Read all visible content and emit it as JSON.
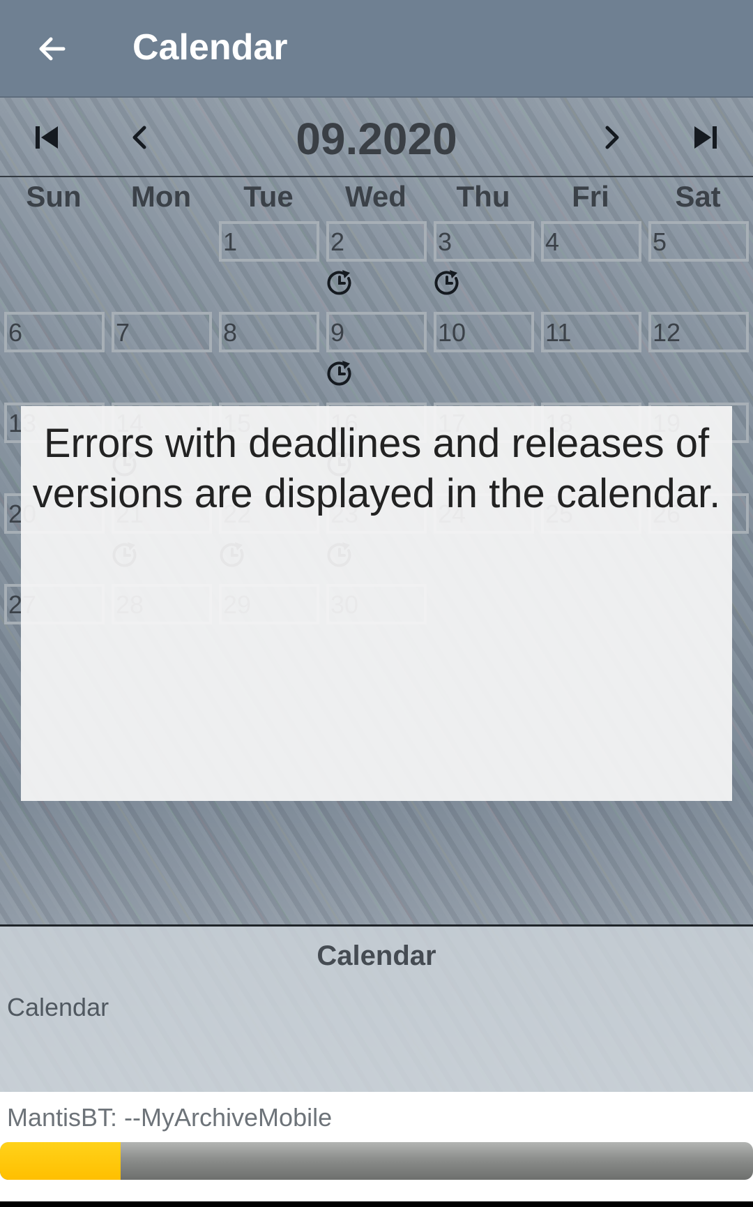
{
  "appbar": {
    "title": "Calendar",
    "back_icon": "arrow-left-icon"
  },
  "nav": {
    "month": "09.2020",
    "first_icon": "skip-first-icon",
    "prev_icon": "chevron-left-icon",
    "next_icon": "chevron-right-icon",
    "last_icon": "skip-last-icon"
  },
  "weekdays": [
    "Sun",
    "Mon",
    "Tue",
    "Wed",
    "Thu",
    "Fri",
    "Sat"
  ],
  "days": [
    "1",
    "2",
    "3",
    "4",
    "5",
    "6",
    "7",
    "8",
    "9",
    "10",
    "11",
    "12",
    "13",
    "14",
    "15",
    "16",
    "17",
    "18",
    "19",
    "20",
    "21",
    "22",
    "23",
    "24",
    "25",
    "26",
    "27",
    "28",
    "29",
    "30"
  ],
  "marker_icon": "deadline-clock-icon",
  "help": {
    "text": "Errors with deadlines and releases of versions are displayed in the calendar."
  },
  "info": {
    "heading": "Calendar",
    "body": "Calendar"
  },
  "footer": {
    "label": "MantisBT: --MyArchiveMobile",
    "progress": 0.16
  },
  "colors": {
    "appbar": "#6f8092",
    "progress_fill": "#ffbf00",
    "progress_track": "#8c8e8c"
  }
}
